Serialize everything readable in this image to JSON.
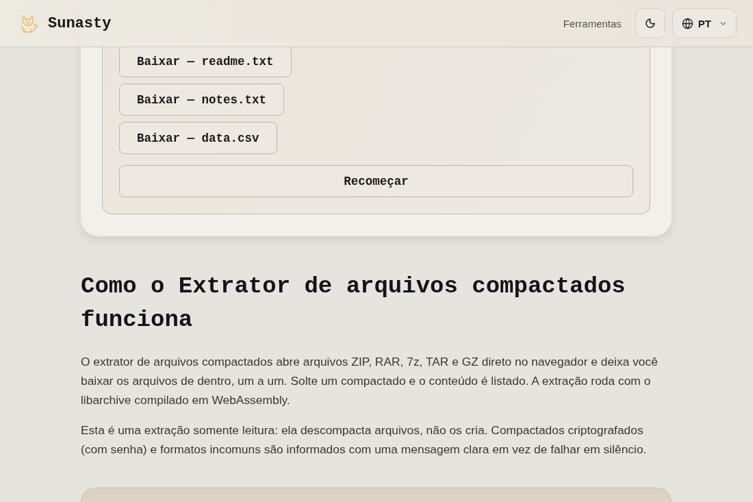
{
  "header": {
    "brand": "Sunasty",
    "nav": [
      {
        "label": "Ferramentas"
      }
    ],
    "language": {
      "code": "PT"
    }
  },
  "extractor": {
    "downloads": [
      {
        "label": "Baixar — readme.txt"
      },
      {
        "label": "Baixar — notes.txt"
      },
      {
        "label": "Baixar — data.csv"
      }
    ],
    "reset_button": "Recomeçar"
  },
  "article": {
    "heading": "Como o Extrator de arquivos compactados funciona",
    "paragraphs": [
      "O extrator de arquivos compactados abre arquivos ZIP, RAR, 7z, TAR e GZ direto no navegador e deixa você baixar os arquivos de dentro, um a um. Solte um compactado e o conteúdo é listado. A extração roda com o libarchive compilado em WebAssembly.",
      "Esta é uma extração somente leitura: ela descompacta arquivos, não os cria. Compactados criptografados (com senha) e formatos incomuns são informados com uma mensagem clara em vez de falhar em silêncio."
    ]
  }
}
